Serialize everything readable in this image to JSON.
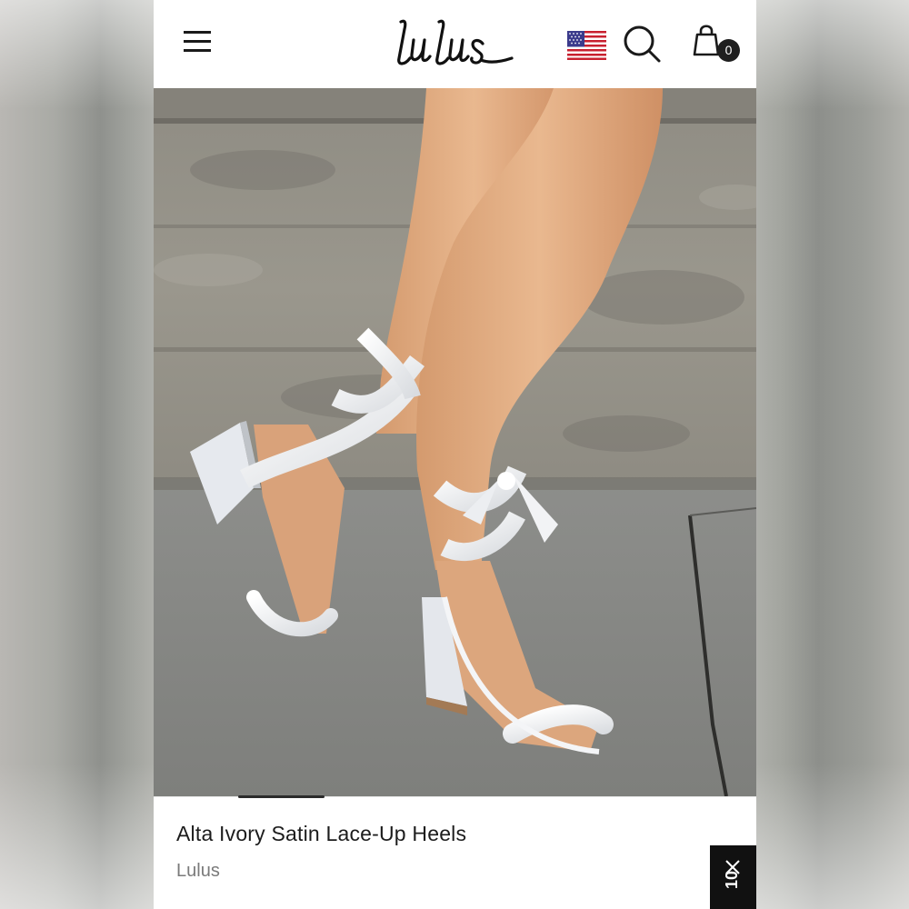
{
  "header": {
    "brand_logo_text": "Lulus",
    "menu_icon": "hamburger-menu-icon",
    "flag_icon": "us-flag-icon",
    "search_icon": "search-icon",
    "cart_icon": "shopping-bag-icon",
    "cart_count": "0"
  },
  "product": {
    "title": "Alta Ivory Satin Lace-Up Heels",
    "brand": "Lulus",
    "image_subject": "ivory satin lace-up block heel sandals"
  },
  "carousel": {
    "active_index": 1
  },
  "promo_tab": {
    "close_icon": "close-icon",
    "text": "10"
  },
  "colors": {
    "header_bg": "#ffffff",
    "text_primary": "#1c1c1c",
    "text_secondary": "#7a7a7a",
    "cart_badge": "#1f1f1f",
    "promo_bg": "#111111"
  }
}
